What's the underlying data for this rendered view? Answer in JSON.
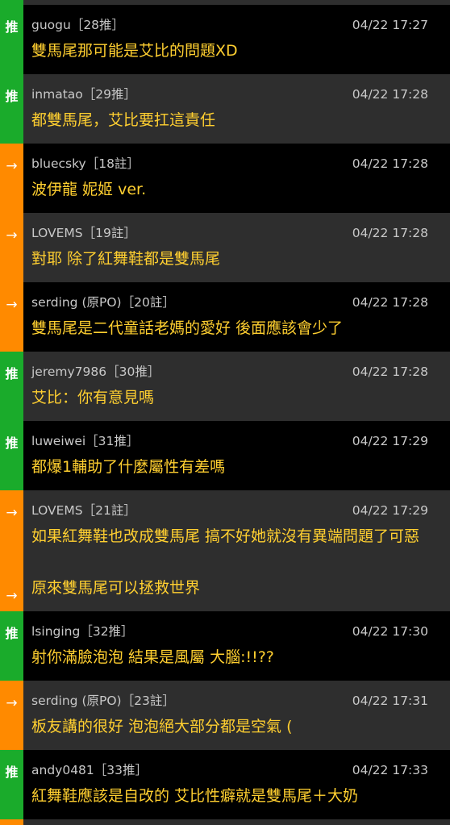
{
  "comments": [
    {
      "tag": "推",
      "tag_type": "push",
      "user": "guogu",
      "floor": "［28推］",
      "time": "04/22 17:27",
      "text": "雙馬尾那可能是艾比的問題XD"
    },
    {
      "tag": "推",
      "tag_type": "push",
      "user": "inmatao",
      "floor": "［29推］",
      "time": "04/22 17:28",
      "text": "都雙馬尾，艾比要扛這責任"
    },
    {
      "tag": "→",
      "tag_type": "arrow",
      "user": "bluecsky",
      "floor": "［18註］",
      "time": "04/22 17:28",
      "text": "波伊龍 妮姬 ver."
    },
    {
      "tag": "→",
      "tag_type": "arrow",
      "user": "LOVEMS",
      "floor": "［19註］",
      "time": "04/22 17:28",
      "text": "對耶 除了紅舞鞋都是雙馬尾"
    },
    {
      "tag": "→",
      "tag_type": "arrow",
      "user": "serding (原PO)",
      "floor": "［20註］",
      "time": "04/22 17:28",
      "text": "雙馬尾是二代童話老媽的愛好 後面應該會少了"
    },
    {
      "tag": "推",
      "tag_type": "push",
      "user": "jeremy7986",
      "floor": "［30推］",
      "time": "04/22 17:28",
      "text": "艾比：你有意見嗎"
    },
    {
      "tag": "推",
      "tag_type": "push",
      "user": "luweiwei",
      "floor": "［31推］",
      "time": "04/22 17:29",
      "text": "都爆1輔助了什麼屬性有差嗎"
    },
    {
      "tag": "→",
      "tag_type": "arrow",
      "user": "LOVEMS",
      "floor": "［21註］",
      "time": "04/22 17:29",
      "text": "如果紅舞鞋也改成雙馬尾 搞不好她就沒有異端問題了可惡",
      "tag2": "→",
      "text2": "原來雙馬尾可以拯救世界"
    },
    {
      "tag": "推",
      "tag_type": "push",
      "user": "lsinging",
      "floor": "［32推］",
      "time": "04/22 17:30",
      "text": "射你滿臉泡泡 結果是風屬 大腦:!!??"
    },
    {
      "tag": "→",
      "tag_type": "arrow",
      "user": "serding (原PO)",
      "floor": "［23註］",
      "time": "04/22 17:31",
      "text": "板友講的很好 泡泡絕大部分都是空氣 ("
    },
    {
      "tag": "推",
      "tag_type": "push",
      "user": "andy0481",
      "floor": "［33推］",
      "time": "04/22 17:33",
      "text": "紅舞鞋應該是自改的 艾比性癖就是雙馬尾＋大奶"
    }
  ]
}
